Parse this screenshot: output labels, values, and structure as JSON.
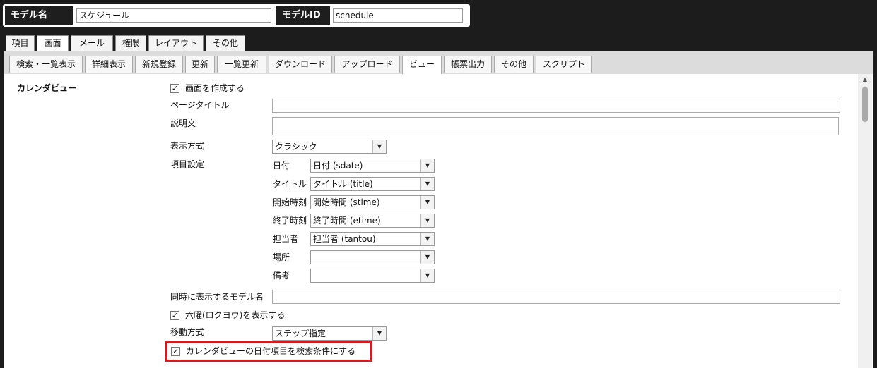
{
  "header": {
    "model_name_label": "モデル名",
    "model_name_value": "スケジュール",
    "model_id_label": "モデルID",
    "model_id_value": "schedule"
  },
  "top_tabs": [
    "項目",
    "画面",
    "メール",
    "権限",
    "レイアウト",
    "その他"
  ],
  "top_tab_active": "画面",
  "sub_tabs": [
    "検索・一覧表示",
    "詳細表示",
    "新規登録",
    "更新",
    "一覧更新",
    "ダウンロード",
    "アップロード",
    "ビュー",
    "帳票出力",
    "その他",
    "スクリプト"
  ],
  "sub_tab_active": "ビュー",
  "calendar": {
    "section_title": "カレンダビュー",
    "create_screen_label": "画面を作成する",
    "create_screen_checked": true,
    "page_title_label": "ページタイトル",
    "page_title_value": "",
    "description_label": "説明文",
    "description_value": "",
    "display_mode_label": "表示方式",
    "display_mode_value": "クラシック",
    "field_settings_label": "項目設定",
    "fields": [
      {
        "label": "日付",
        "value": "日付 (sdate)"
      },
      {
        "label": "タイトル",
        "value": "タイトル (title)"
      },
      {
        "label": "開始時刻",
        "value": "開始時間 (stime)"
      },
      {
        "label": "終了時刻",
        "value": "終了時間 (etime)"
      },
      {
        "label": "担当者",
        "value": "担当者 (tantou)"
      },
      {
        "label": "場所",
        "value": ""
      },
      {
        "label": "備考",
        "value": ""
      }
    ],
    "concurrent_model_label": "同時に表示するモデル名",
    "concurrent_model_value": "",
    "rokuyo_label": "六曜(ロクヨウ)を表示する",
    "rokuyo_checked": true,
    "move_mode_label": "移動方式",
    "move_mode_value": "ステップ指定",
    "date_search_label": "カレンダビューの日付項目を検索条件にする",
    "date_search_checked": true,
    "checkmark": "✓"
  },
  "icons": {
    "dropdown": "▼",
    "scroll_up": "▲"
  },
  "colors": {
    "highlight": "#e0161b",
    "header_bg": "#1c1c1c"
  }
}
